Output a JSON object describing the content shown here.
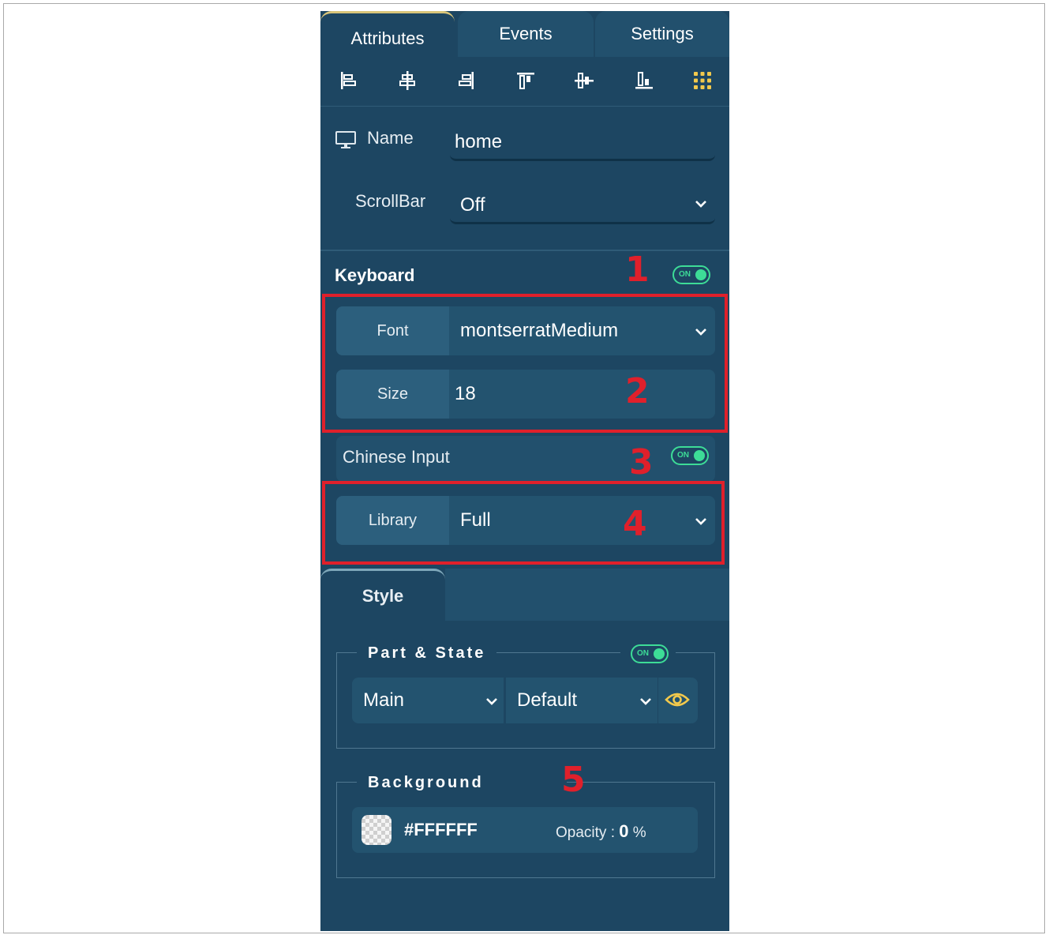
{
  "tabs": {
    "attributes": "Attributes",
    "events": "Events",
    "settings": "Settings",
    "active": "Attributes"
  },
  "toolbar": {
    "icons": [
      "align-left-icon",
      "align-center-horizontal-icon",
      "align-right-icon",
      "align-top-icon",
      "align-center-vertical-icon",
      "align-bottom-icon",
      "grid-icon"
    ]
  },
  "name_field": {
    "label": "Name",
    "value": "home",
    "icon": "monitor-icon"
  },
  "scrollbar_field": {
    "label": "ScrollBar",
    "value": "Off"
  },
  "keyboard": {
    "title": "Keyboard",
    "toggle": "ON",
    "font": {
      "label": "Font",
      "value": "montserratMedium"
    },
    "size": {
      "label": "Size",
      "value": "18"
    }
  },
  "chinese_input": {
    "label": "Chinese Input",
    "toggle": "ON",
    "library": {
      "label": "Library",
      "value": "Full"
    }
  },
  "style": {
    "tab_label": "Style",
    "part_state": {
      "legend": "Part & State",
      "toggle": "ON",
      "part": "Main",
      "state": "Default"
    },
    "background": {
      "legend": "Background",
      "color": "#FFFFFF",
      "opacity_label": "Opacity :",
      "opacity_value": "0",
      "opacity_unit": "%"
    }
  },
  "annotations": [
    "1",
    "2",
    "3",
    "4",
    "5"
  ],
  "colors": {
    "panel_bg": "#1d4662",
    "accent_green": "#3ddc97",
    "annotation_red": "#e0202b",
    "active_tab_border": "#d9c57a"
  }
}
